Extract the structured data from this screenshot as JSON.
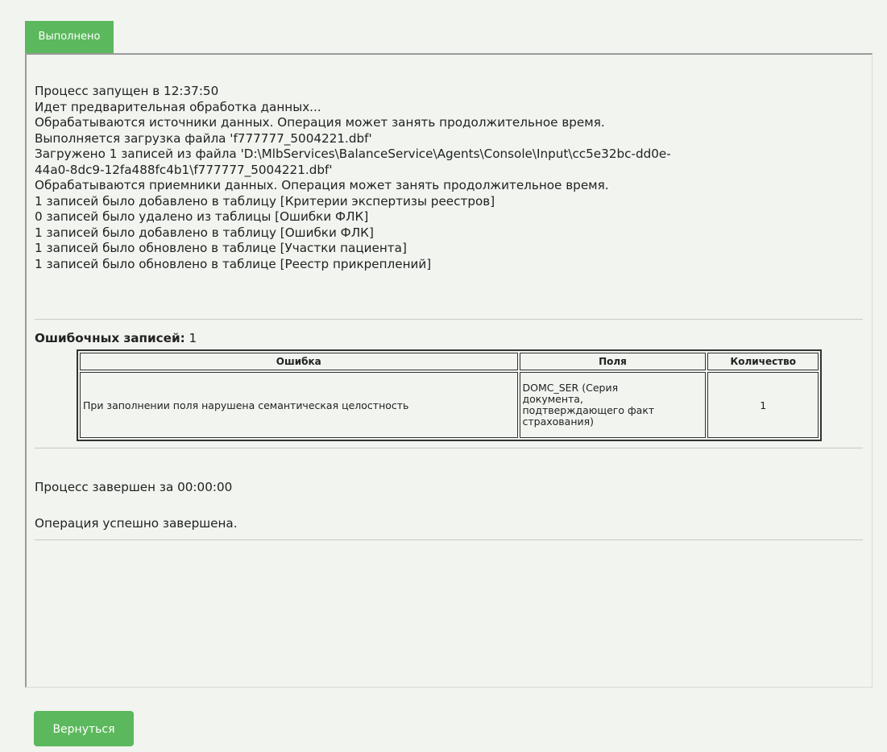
{
  "tab": {
    "label": "Выполнено"
  },
  "log": {
    "lines": [
      "Процесс запущен в 12:37:50",
      "Идет предварительная обработка данных...",
      "Обрабатываются источники данных. Операция может занять продолжительное время.",
      "Выполняется загрузка файла 'f777777_5004221.dbf'",
      "Загружено 1 записей из файла 'D:\\MlbServices\\BalanceService\\Agents\\Console\\Input\\cc5e32bc-dd0e-",
      "44a0-8dc9-12fa488fc4b1\\f777777_5004221.dbf'",
      "Обрабатываются приемники данных. Операция может занять продолжительное время.",
      "1 записей было добавлено в таблицу [Критерии экспертизы реестров]",
      "0 записей было удалено из таблицы [Ошибки ФЛК]",
      "1 записей было добавлено в таблицу [Ошибки ФЛК]",
      "1 записей было обновлено в таблице [Участки пациента]",
      "1 записей было обновлено в таблице [Реестр прикреплений]"
    ]
  },
  "errors": {
    "label": "Ошибочных записей:",
    "count": "1",
    "headers": {
      "error": "Ошибка",
      "fields": "Поля",
      "quantity": "Количество"
    },
    "rows": [
      {
        "error": "При заполнении поля нарушена семантическая целостность",
        "fields_lines": [
          "DOMC_SER (Серия",
          "документа,",
          "подтверждающего факт",
          "страхования)"
        ],
        "quantity": "1"
      }
    ]
  },
  "finish": {
    "text": "Процесс завершен за 00:00:00"
  },
  "result": {
    "text": "Операция успешно завершена."
  },
  "actions": {
    "back_label": "Вернуться"
  },
  "colors": {
    "accent": "#5cb85c",
    "background": "#f1f4ef"
  }
}
